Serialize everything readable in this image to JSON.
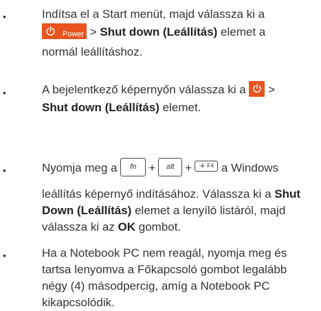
{
  "bullet": "•",
  "items": [
    {
      "line1": "Indítsa el a Start menüt, majd válassza ki a",
      "power_label": "Power",
      "gt": " > ",
      "bold": "Shut down (Leállítás)",
      "after_bold": " elemet a",
      "line3": "normál leállításhoz."
    },
    {
      "line1_pre": "A bejelentkező képernyőn válassza ki a ",
      "gt": " >",
      "bold": "Shut down (Leállítás)",
      "after_bold": " elemet."
    },
    {
      "pre": "Nyomja meg a ",
      "key_fn": "fn",
      "key_alt": "alt",
      "key_f4": "F4",
      "plus": "+",
      "post": " a Windows",
      "line2": "leállítás képernyő indításához. Válassza ki a ",
      "line2_bold": "Shut",
      "line3_bold": "Down (Leállítás)",
      "line3_rest": " elemet a lenyíló listáról, majd",
      "line4_pre": "válassza ki az ",
      "line4_bold": "OK",
      "line4_post": " gombot."
    },
    {
      "line1": "Ha a Notebook PC nem reagál, nyomja meg és",
      "line2": "tartsa lenyomva a Főkapcsoló gombot legalább",
      "line3": "négy (4) másodpercig, amíg a Notebook PC",
      "line4": "kikapcsolódik."
    }
  ],
  "colors": {
    "power_tile": "#e8541f",
    "text": "#333333"
  },
  "icons": [
    "power-icon",
    "plus-sign",
    "brightness-icon"
  ]
}
